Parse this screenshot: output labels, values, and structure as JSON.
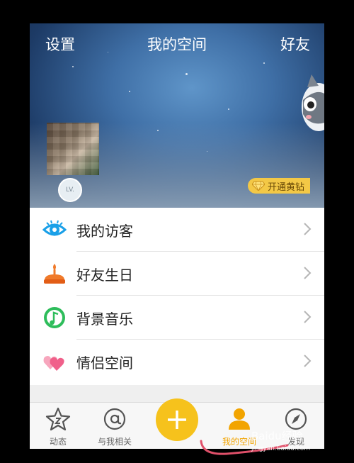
{
  "header": {
    "left_action": "设置",
    "title": "我的空间",
    "right_action": "好友",
    "level_badge": "LV.",
    "vip_label": "开通黄钻"
  },
  "menu": [
    {
      "label": "我的访客",
      "icon": "eye-icon",
      "color": "#1aa0e8"
    },
    {
      "label": "好友生日",
      "icon": "birthday-cake-icon",
      "color": "#f07a2a"
    },
    {
      "label": "背景音乐",
      "icon": "music-note-icon",
      "color": "#2ebd5b"
    },
    {
      "label": "情侣空间",
      "icon": "hearts-icon",
      "color": "#f0608a"
    }
  ],
  "tabbar": {
    "tabs": [
      {
        "label": "动态",
        "icon": "star-icon"
      },
      {
        "label": "与我相关",
        "icon": "at-icon"
      },
      {
        "label": "",
        "icon": "plus-icon"
      },
      {
        "label": "我的空间",
        "icon": "person-icon"
      },
      {
        "label": "发现",
        "icon": "compass-icon"
      }
    ],
    "active_color": "#f2a400"
  },
  "watermark": {
    "brand": "Baidu经验",
    "url": "jingyan.baidu.com"
  }
}
